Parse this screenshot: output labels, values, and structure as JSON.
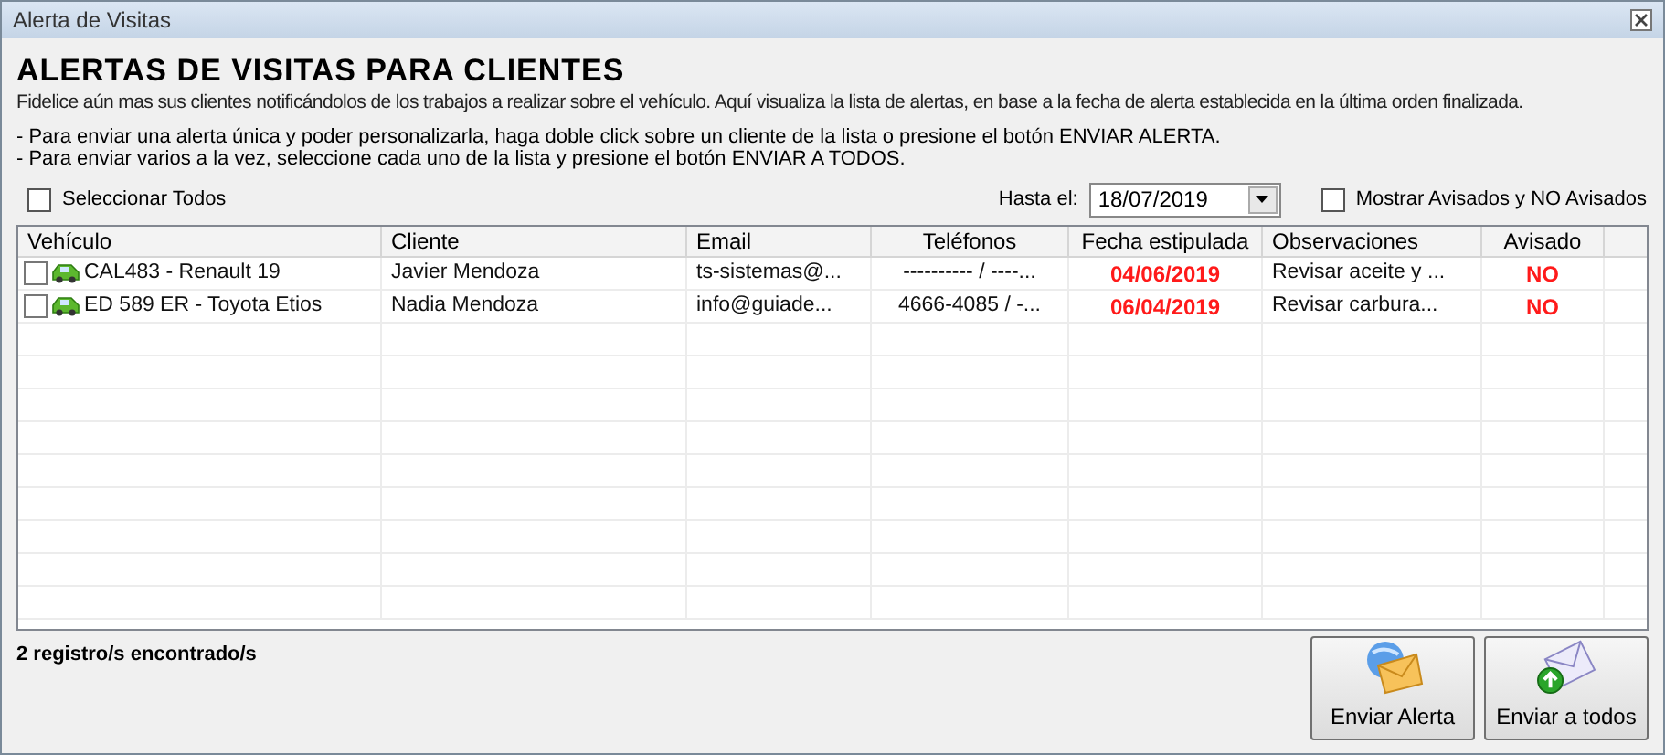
{
  "window": {
    "title": "Alerta de Visitas"
  },
  "heading": "ALERTAS DE VISITAS PARA CLIENTES",
  "description": "Fidelice aún mas sus clientes notificándolos de los trabajos a realizar sobre el vehículo. Aquí visualiza la lista de alertas, en base a la fecha de alerta establecida en la última orden finalizada.",
  "instructions": [
    "- Para enviar una alerta única y poder personalizarla, haga doble click sobre un cliente de la lista o presione el botón ENVIAR ALERTA.",
    "- Para enviar varios a la vez, seleccione cada uno de la lista y presione el botón ENVIAR A TODOS."
  ],
  "select_all": {
    "label": "Seleccionar Todos",
    "checked": false
  },
  "date_filter": {
    "label": "Hasta el:",
    "value": "18/07/2019"
  },
  "show_all": {
    "label": "Mostrar Avisados y NO Avisados",
    "checked": false
  },
  "table": {
    "columns": [
      "Vehículo",
      "Cliente",
      "Email",
      "Teléfonos",
      "Fecha estipulada",
      "Observaciones",
      "Avisado"
    ],
    "rows": [
      {
        "checked": false,
        "cells": [
          "CAL483 - Renault 19",
          "Javier Mendoza",
          "ts-sistemas@...",
          "---------- / ----...",
          "04/06/2019",
          "Revisar aceite y ...",
          "NO"
        ]
      },
      {
        "checked": false,
        "cells": [
          "ED 589 ER - Toyota Etios",
          "Nadia Mendoza",
          "info@guiade...",
          "4666-4085 / -...",
          "06/04/2019",
          "Revisar carbura...",
          "NO"
        ]
      }
    ]
  },
  "status": "2 registro/s encontrado/s",
  "buttons": [
    {
      "kind": "alert",
      "label": "Enviar Alerta"
    },
    {
      "kind": "all",
      "label": "Enviar a todos"
    }
  ]
}
